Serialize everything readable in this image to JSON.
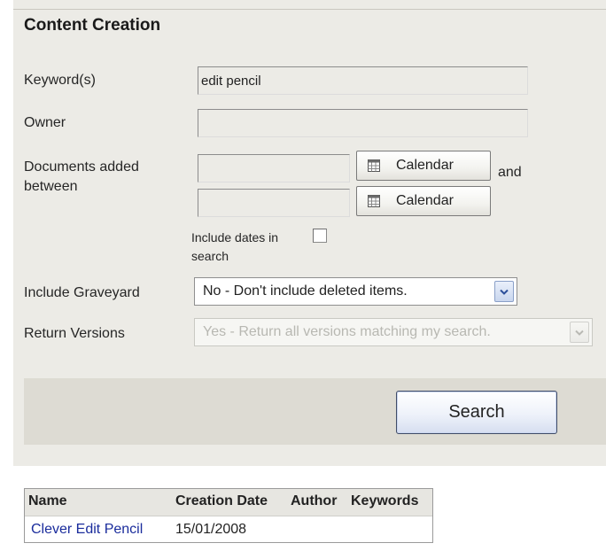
{
  "section": {
    "title": "Content Creation"
  },
  "form": {
    "keywords": {
      "label": "Keyword(s)",
      "value": "edit pencil"
    },
    "owner": {
      "label": "Owner",
      "value": ""
    },
    "documents_added": {
      "label_line1": "Documents added",
      "label_line2": "between",
      "from_value": "",
      "to_value": "",
      "calendar_button_1": "Calendar",
      "calendar_button_2": "Calendar",
      "and_text": "and"
    },
    "include_dates": {
      "label_line1": "Include dates in",
      "label_line2": "search",
      "checked": false
    },
    "include_graveyard": {
      "label": "Include Graveyard",
      "selected": "No - Don't include deleted items."
    },
    "return_versions": {
      "label": "Return Versions",
      "selected": "Yes - Return all versions matching my search.",
      "disabled": true
    }
  },
  "search_button": {
    "label": "Search"
  },
  "results": {
    "columns": [
      "Name",
      "Creation Date",
      "Author",
      "Keywords"
    ],
    "rows": [
      {
        "name": "Clever Edit Pencil",
        "creation_date": "15/01/2008",
        "author": "",
        "keywords": ""
      }
    ]
  },
  "icons": {
    "calendar": "calendar-icon",
    "dropdown": "chevron-down-icon"
  },
  "colors": {
    "panel_background": "#ecebe6",
    "search_bar_background": "#dddbd3",
    "link": "#1a2c9c",
    "select_arrow": "#2b4f9a"
  }
}
